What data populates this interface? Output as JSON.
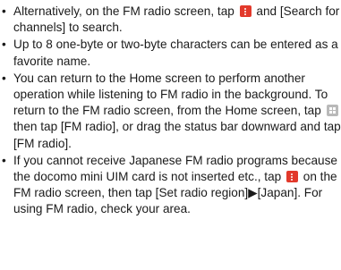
{
  "notes": [
    {
      "segments": [
        "Alternatively, on the FM radio screen, tap",
        "and [Search for channels] to search."
      ]
    },
    {
      "segments": [
        "Up to 8 one-byte or two-byte characters can be entered as a favorite name."
      ]
    },
    {
      "segments": [
        "You can return to the Home screen to perform another operation while listening to FM radio in the background. To return to the FM radio screen, from the Home screen, tap",
        "then tap [FM radio], or drag the status bar downward and tap [FM radio]."
      ]
    },
    {
      "segments": [
        "If you cannot receive Japanese FM radio programs because the docomo mini UIM card is not inserted etc., tap",
        "on the FM radio screen, then tap [Set radio region]▶[Japan]. For using FM radio, check your area."
      ]
    }
  ],
  "bullet": "•",
  "icons": {
    "menu": {
      "name": "menu-icon",
      "color": "#e2392b"
    },
    "apps": {
      "name": "apps-icon",
      "color": "#b9b9b9"
    }
  }
}
